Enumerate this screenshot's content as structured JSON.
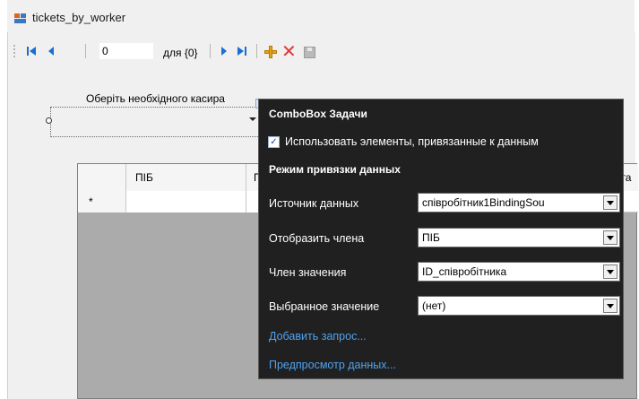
{
  "window": {
    "title": "tickets_by_worker",
    "icon": "form-icon"
  },
  "navigator": {
    "position_value": "0",
    "count_label": "для {0}",
    "icons": [
      "move-first-icon",
      "move-previous-icon",
      "move-next-icon",
      "move-last-icon",
      "add-new-icon",
      "delete-icon",
      "save-icon"
    ]
  },
  "form": {
    "cashier_label": "Оберіть необхідного касира"
  },
  "grid": {
    "columns": [
      "ПІБ",
      "П",
      "ата"
    ],
    "new_row_marker": "*"
  },
  "tasks_panel": {
    "title": "ComboBox Задачи",
    "use_data_bound_items": {
      "label": "Использовать элементы, привязанные к данным",
      "checked": true
    },
    "binding_mode_header": "Режим привязки данных",
    "properties": [
      {
        "label": "Источник данных",
        "value": "співробітник1BindingSou"
      },
      {
        "label": "Отобразить члена",
        "value": "ПІБ"
      },
      {
        "label": "Член значения",
        "value": "ID_співробітника"
      },
      {
        "label": "Выбранное значение",
        "value": "(нет)"
      }
    ],
    "links": [
      "Добавить запрос...",
      "Предпросмотр данных..."
    ]
  },
  "colors": {
    "panel_bg": "#202020",
    "link": "#4fa3f0",
    "nav_arrow": "#1b6fd3",
    "delete": "#e23636"
  }
}
